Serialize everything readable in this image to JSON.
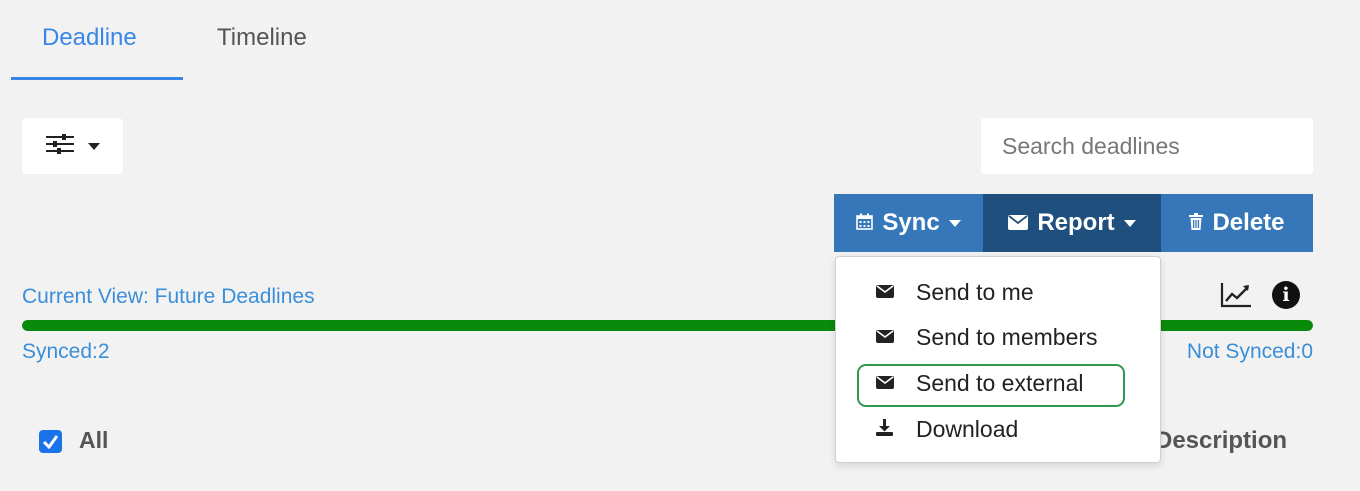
{
  "tabs": [
    {
      "label": "Deadline",
      "active": true
    },
    {
      "label": "Timeline",
      "active": false
    }
  ],
  "filter": {
    "icon": "sliders-icon"
  },
  "search": {
    "placeholder": "Search deadlines",
    "value": ""
  },
  "actions": {
    "sync_label": "Sync",
    "report_label": "Report",
    "delete_label": "Delete"
  },
  "view": {
    "current_view": "Current View: Future Deadlines",
    "synced": "Synced:2",
    "not_synced": "Not Synced:0",
    "sync_progress": 1.0
  },
  "table": {
    "all_label": "All",
    "all_checked": true,
    "description_header": "Description"
  },
  "report_menu": {
    "items": [
      {
        "label": "Send to me",
        "icon": "envelope-icon"
      },
      {
        "label": "Send to members",
        "icon": "envelope-icon"
      },
      {
        "label": "Send to external",
        "icon": "envelope-icon",
        "highlighted": true
      },
      {
        "label": "Download",
        "icon": "download-icon"
      }
    ]
  },
  "colors": {
    "accent": "#3a86e8",
    "sync_button": "#3577b8",
    "report_button": "#1e4f7d",
    "progress": "#0a8a0a",
    "highlight_border": "#2e9a4e"
  }
}
